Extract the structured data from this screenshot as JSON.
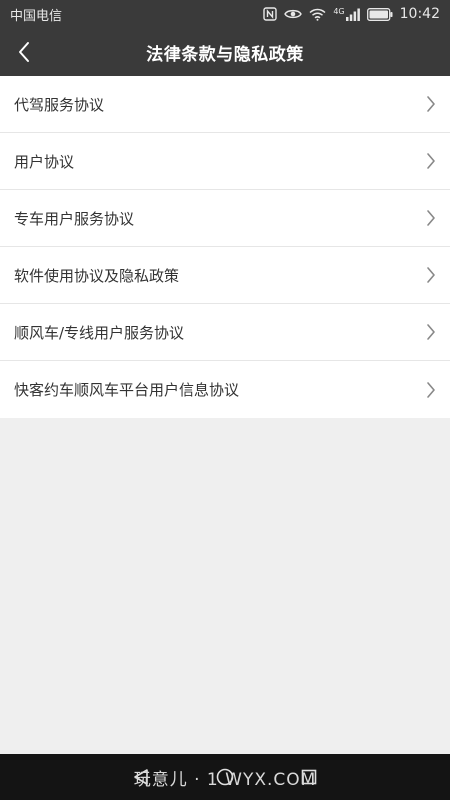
{
  "status_bar": {
    "carrier": "中国电信",
    "signal_label": "4G",
    "time": "10:42",
    "icons": [
      "nfc-icon",
      "eye-icon",
      "wifi-icon",
      "signal-icon",
      "battery-icon"
    ]
  },
  "header": {
    "title": "法律条款与隐私政策",
    "back_icon": "chevron-left-icon"
  },
  "list": {
    "items": [
      {
        "label": "代驾服务协议"
      },
      {
        "label": "用户协议"
      },
      {
        "label": "专车用户服务协议"
      },
      {
        "label": "软件使用协议及隐私政策"
      },
      {
        "label": "顺风车/专线用户服务协议"
      },
      {
        "label": "快客约车顺风车平台用户信息协议"
      }
    ]
  },
  "system_nav": {
    "icons": [
      "back-triangle-icon",
      "home-circle-icon",
      "recents-square-icon"
    ]
  },
  "watermark": "玩意儿 · 1 WYX.COM",
  "colors": {
    "bar_background": "#3a3a3a",
    "page_background": "#efefef",
    "list_background": "#ffffff",
    "text": "#333333",
    "chevron": "#888888",
    "system_nav": "#141414"
  }
}
